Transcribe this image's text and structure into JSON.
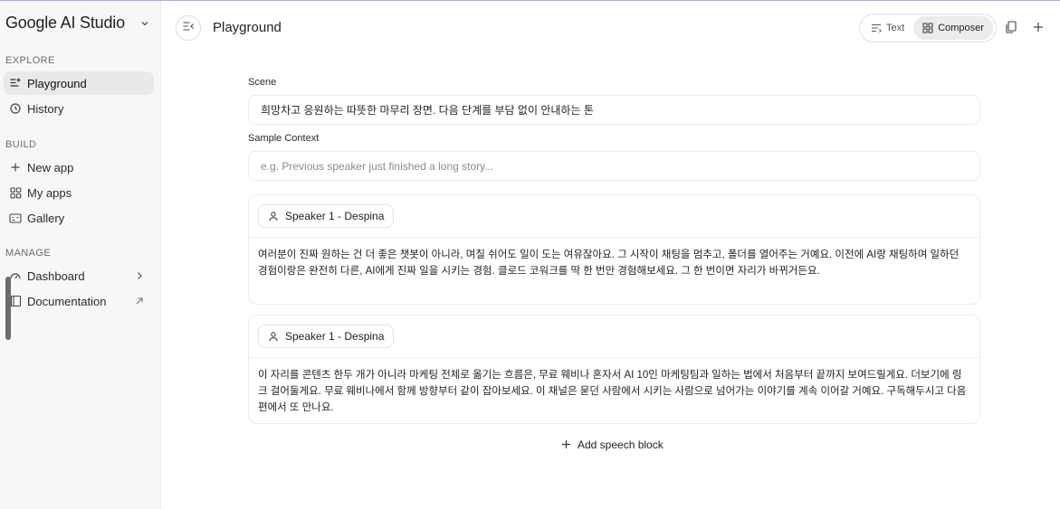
{
  "sidebar": {
    "brand": "Google AI Studio",
    "sections": {
      "explore": "EXPLORE",
      "build": "BUILD",
      "manage": "MANAGE"
    },
    "items": {
      "playground": "Playground",
      "history": "History",
      "new_app": "New app",
      "my_apps": "My apps",
      "gallery": "Gallery",
      "dashboard": "Dashboard",
      "documentation": "Documentation"
    }
  },
  "topbar": {
    "title": "Playground",
    "mode_text": "Text",
    "mode_composer": "Composer",
    "active_mode": "Composer"
  },
  "main": {
    "scene_label": "Scene",
    "scene_value": "희망차고 응원하는 따뜻한 마무리 장면. 다음 단계를 부담 없이 안내하는 톤",
    "context_label": "Sample Context",
    "context_placeholder": "e.g. Previous speaker just finished a long story...",
    "speech_blocks": [
      {
        "speaker": "Speaker 1 - Despina",
        "text": "여러분이 진짜 원하는 건 더 좋은 챗봇이 아니라, 며칠 쉬어도 일이 도는 여유잖아요. 그 시작이 채팅을 멈추고, 폴더를 열어주는 거예요. 이전에 AI랑 채팅하며 일하던 경험이랑은 완전히 다른, AI에게 진짜 일을 시키는 경험. 클로드 코워크를 딱 한 번만 경험해보세요. 그 한 번이면 자리가 바뀌거든요."
      },
      {
        "speaker": "Speaker 1 - Despina",
        "text": "이 자리를 콘텐츠 한두 개가 아니라 마케팅 전체로 옮기는 흐름은, 무료 웨비나 혼자서 AI 10인 마케팅팀과 일하는 법에서 처음부터 끝까지 보여드릴게요. 더보기에 링크 걸어둘게요.  무료 웨비나에서 함께 방향부터 같이 잡아보세요. 이 채널은 묻던 사람에서 시키는 사람으로 넘어가는 이야기를 계속 이어갈 거예요. 구독해두시고 다음 편에서 또 만나요."
      }
    ],
    "add_block_label": "Add speech block"
  },
  "colors": {
    "accent_border": "#b7a4e8",
    "sidebar_bg": "#f7f7f8",
    "active_bg": "#e9e9ec"
  }
}
